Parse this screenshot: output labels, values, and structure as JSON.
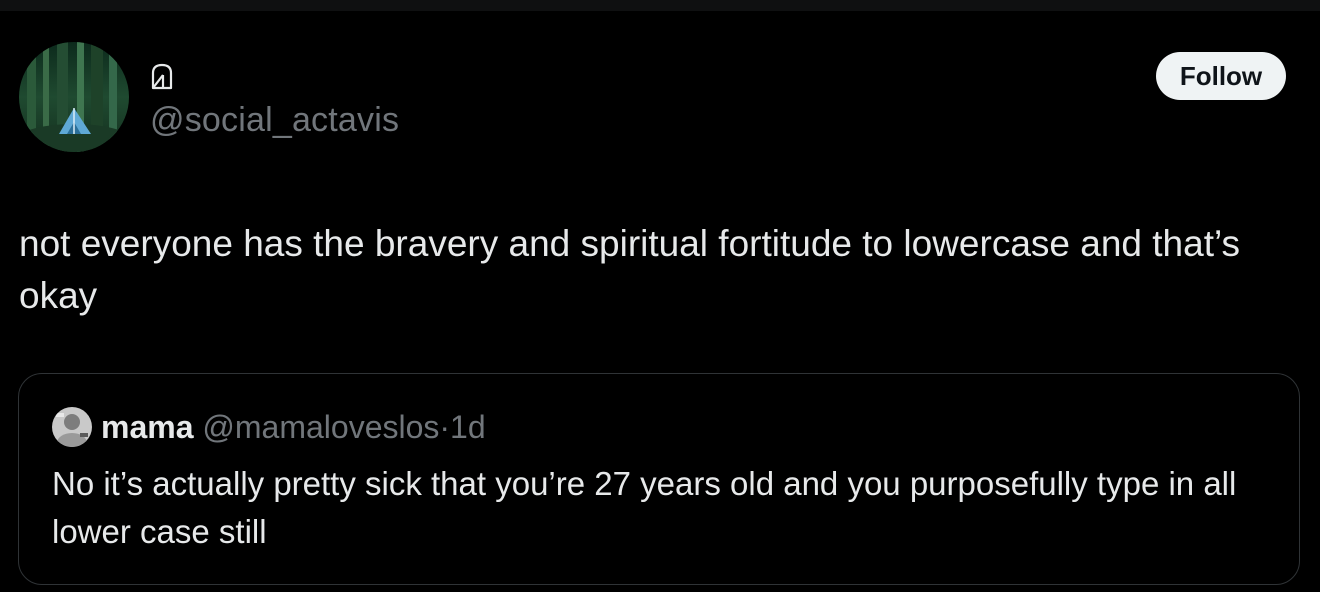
{
  "author": {
    "display_name_icon": "doorway-icon",
    "handle": "@social_actavis",
    "follow_label": "Follow"
  },
  "tweet": {
    "text": "not everyone has the bravery and spiritual fortitude to lowercase and that’s okay"
  },
  "quoted": {
    "name": "mama",
    "handle": "@mamaloveslos",
    "separator": "·",
    "time": "1d",
    "text": "No it’s actually pretty sick that you’re 27 years old and you purposefully type in all lower case still"
  },
  "colors": {
    "background": "#000000",
    "text_primary": "#e7e9ea",
    "text_secondary": "#71767b",
    "border": "#2f3336",
    "follow_bg": "#eff3f4",
    "follow_text": "#0f1419"
  }
}
